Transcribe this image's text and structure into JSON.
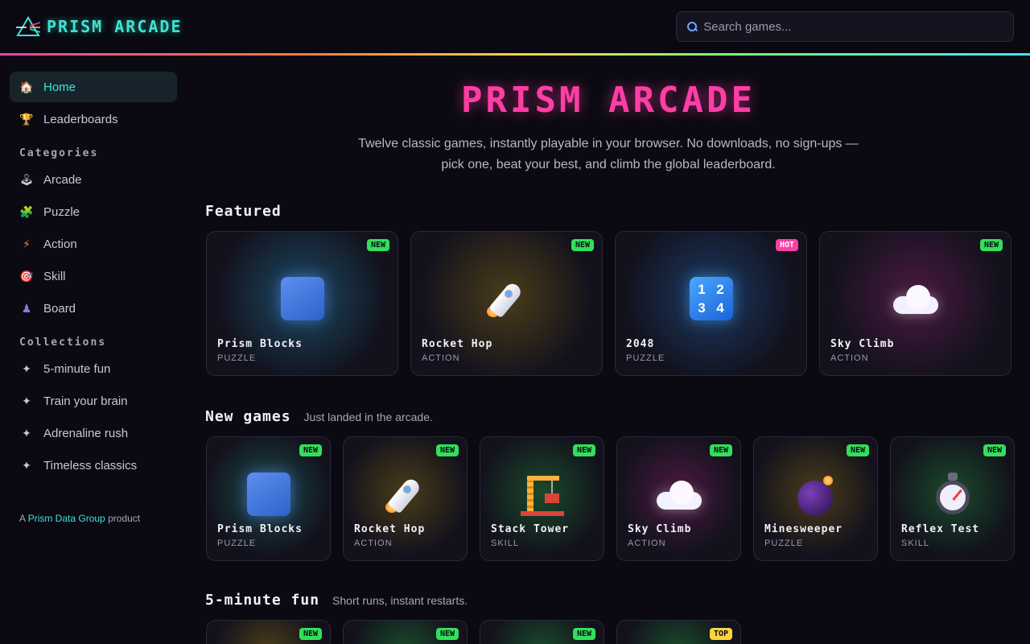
{
  "header": {
    "brand": "PRISM ARCADE",
    "search_placeholder": "Search games..."
  },
  "sidebar": {
    "main_items": [
      {
        "label": "Home",
        "icon": "house-icon",
        "active": true
      },
      {
        "label": "Leaderboards",
        "icon": "trophy-icon"
      }
    ],
    "categories_title": "Categories",
    "categories": [
      {
        "label": "Arcade",
        "icon": "joystick-icon"
      },
      {
        "label": "Puzzle",
        "icon": "puzzle-piece-icon"
      },
      {
        "label": "Action",
        "icon": "lightning-icon"
      },
      {
        "label": "Skill",
        "icon": "target-icon"
      },
      {
        "label": "Board",
        "icon": "chess-pawn-icon"
      }
    ],
    "collections_title": "Collections",
    "collections": [
      {
        "label": "5-minute fun",
        "icon": "sparkle-icon"
      },
      {
        "label": "Train your brain",
        "icon": "sparkle-icon"
      },
      {
        "label": "Adrenaline rush",
        "icon": "sparkle-icon"
      },
      {
        "label": "Timeless classics",
        "icon": "sparkle-icon"
      }
    ],
    "footer": {
      "prefix": "A",
      "link": "Prism Data Group",
      "suffix": "product"
    }
  },
  "hero": {
    "title": "PRISM ARCADE",
    "subtitle": "Twelve classic games, instantly playable in your browser. No downloads, no sign-ups — pick one, beat your best, and climb the global leaderboard."
  },
  "featured": {
    "title": "Featured",
    "cards": [
      {
        "name": "Prism Blocks",
        "genre": "PUZZLE",
        "badge": "NEW",
        "icon": "blue-block-icon",
        "glow": "#1c4a63"
      },
      {
        "name": "Rocket Hop",
        "genre": "ACTION",
        "badge": "NEW",
        "icon": "rocket-icon",
        "glow": "#4a3c1a"
      },
      {
        "name": "2048",
        "genre": "PUZZLE",
        "badge": "HOT",
        "icon": "number-tiles-icon",
        "glow": "#1c3a63"
      },
      {
        "name": "Sky Climb",
        "genre": "ACTION",
        "badge": "NEW",
        "icon": "cloud-icon",
        "glow": "#4a1a40"
      }
    ]
  },
  "new_games": {
    "title": "New games",
    "subtitle": "Just landed in the arcade.",
    "cards": [
      {
        "name": "Prism Blocks",
        "genre": "PUZZLE",
        "badge": "NEW",
        "icon": "blue-block-icon",
        "glow": "#1c4a4a"
      },
      {
        "name": "Rocket Hop",
        "genre": "ACTION",
        "badge": "NEW",
        "icon": "rocket-icon",
        "glow": "#4a3c1a"
      },
      {
        "name": "Stack Tower",
        "genre": "SKILL",
        "badge": "NEW",
        "icon": "crane-icon",
        "glow": "#1a4a2a"
      },
      {
        "name": "Sky Climb",
        "genre": "ACTION",
        "badge": "NEW",
        "icon": "cloud-icon",
        "glow": "#4a1a40"
      },
      {
        "name": "Minesweeper",
        "genre": "PUZZLE",
        "badge": "NEW",
        "icon": "bomb-icon",
        "glow": "#4a3c1a"
      },
      {
        "name": "Reflex Test",
        "genre": "SKILL",
        "badge": "NEW",
        "icon": "stopwatch-icon",
        "glow": "#1a4a2a"
      }
    ]
  },
  "five_minute": {
    "title": "5-minute fun",
    "subtitle": "Short runs, instant restarts.",
    "cards": [
      {
        "badge": "NEW",
        "glow": "#4a3c1a"
      },
      {
        "badge": "NEW",
        "glow": "#1a4a2a"
      },
      {
        "badge": "NEW",
        "glow": "#1a4a2a"
      },
      {
        "badge": "TOP",
        "glow": "#1a4a2a"
      }
    ]
  },
  "colors": {
    "accent_cyan": "#3ee3d2",
    "accent_pink": "#ff3ea5",
    "badge_new": "#31e05a",
    "badge_hot": "#ff3ea5",
    "badge_top": "#ffd23e"
  }
}
